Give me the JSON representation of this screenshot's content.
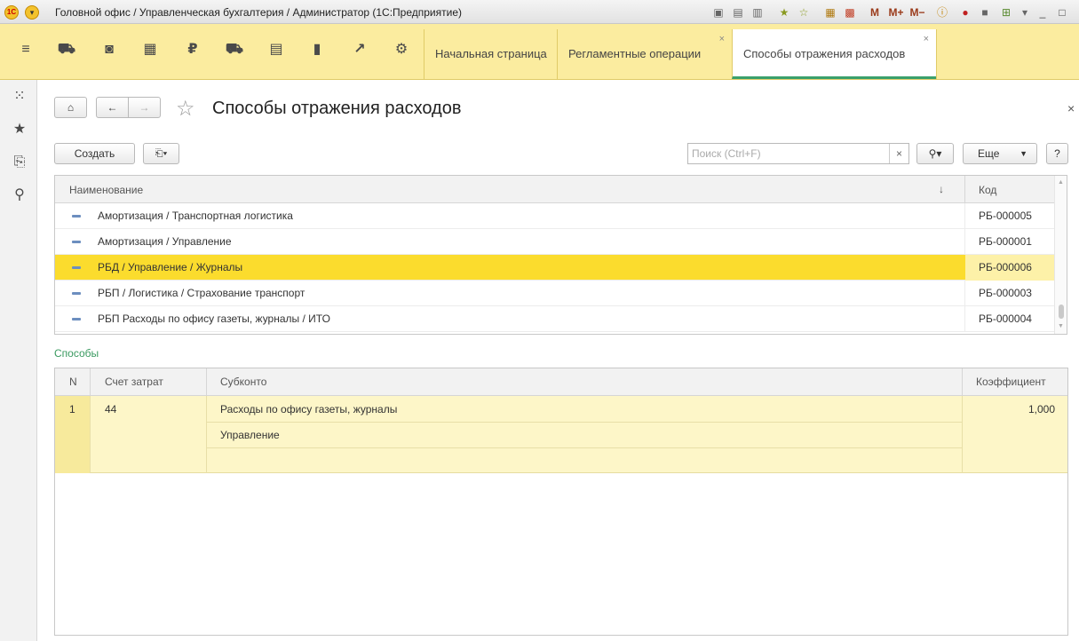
{
  "window": {
    "title": "Головной офис / Управленческая бухгалтерия / Администратор  (1С:Предприятие)",
    "logo_text": "1С"
  },
  "tabs": [
    {
      "label": "Начальная страница"
    },
    {
      "label": "Регламентные операции"
    },
    {
      "label": "Способы отражения расходов"
    }
  ],
  "form": {
    "title": "Способы отражения расходов",
    "create_label": "Создать",
    "search_placeholder": "Поиск (Ctrl+F)",
    "more_label": "Еще",
    "help_label": "?"
  },
  "list": {
    "columns": [
      "Наименование",
      "Код"
    ],
    "sort_indicator": "↓",
    "rows": [
      {
        "name": "Амортизация / Транспортная логистика",
        "code": "РБ-000005"
      },
      {
        "name": "Амортизация / Управление",
        "code": "РБ-000001"
      },
      {
        "name": "РБД / Управление / Журналы",
        "code": "РБ-000006",
        "selected": true
      },
      {
        "name": "РБП / Логистика / Страхование транспорт",
        "code": "РБ-000003"
      },
      {
        "name": "РБП Расходы по офису газеты, журналы / ИТО",
        "code": "РБ-000004"
      }
    ]
  },
  "section": {
    "label": "Способы"
  },
  "detail": {
    "columns": [
      "N",
      "Счет затрат",
      "Субконто",
      "Коэффициент"
    ],
    "rows": [
      {
        "n": "1",
        "account": "44",
        "subconto1": "Расходы по офису газеты, журналы",
        "subconto2": "Управление",
        "coefficient": "1,000"
      }
    ]
  },
  "colors": {
    "accent_yellow": "#fbec9f",
    "selection": "#fbdc2d",
    "section_green": "#3a9a60"
  }
}
